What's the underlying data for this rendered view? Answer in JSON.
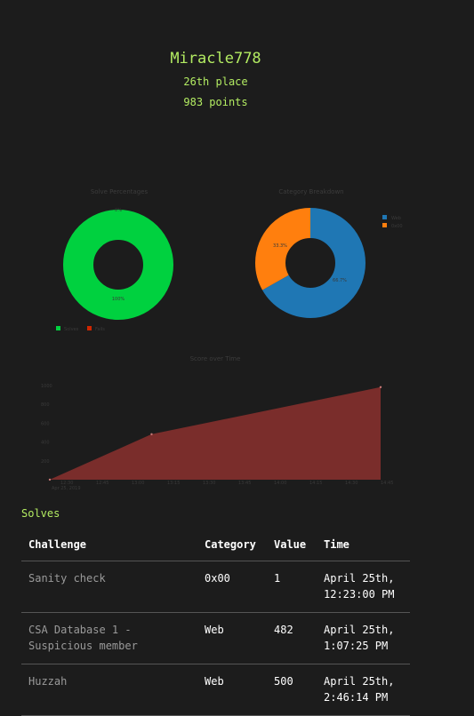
{
  "user": {
    "name": "Miracle778",
    "place": "26th place",
    "score": "983 points"
  },
  "charts": {
    "solve_title": "Solve Percentages",
    "category_title": "Category Breakdown",
    "score_title": "Score over Time"
  },
  "chart_data": [
    {
      "type": "pie",
      "title": "Solve Percentages",
      "labels": [
        "Solves",
        "Fails"
      ],
      "values": [
        100,
        0
      ],
      "slice_labels": [
        "0%",
        "100%"
      ],
      "colors": [
        "#00d13f",
        "#cf2600"
      ],
      "legend": "bottom-left"
    },
    {
      "type": "pie",
      "title": "Category Breakdown",
      "labels": [
        "Web",
        "0x00"
      ],
      "values": [
        66.7,
        33.3
      ],
      "slice_labels": [
        "66.7%",
        "33.3%"
      ],
      "colors": [
        "#1f77b4",
        "#ff7f0e"
      ],
      "legend": "top-right"
    },
    {
      "type": "area",
      "title": "Score over Time",
      "x": [
        "12:23",
        "13:07",
        "14:46"
      ],
      "y": [
        1,
        483,
        983
      ],
      "tick_labels": [
        "12:30\nApr 25, 2019",
        "12:45",
        "13:00",
        "13:15",
        "13:30",
        "13:45",
        "14:00",
        "14:15",
        "14:30",
        "14:45"
      ],
      "y_ticks": [
        "200",
        "400",
        "600",
        "800",
        "1000"
      ],
      "color": "#7a2d2b",
      "grid": false
    }
  ],
  "solves": {
    "heading": "Solves",
    "columns": [
      "Challenge",
      "Category",
      "Value",
      "Time"
    ],
    "rows": [
      {
        "challenge": "Sanity check",
        "category": "0x00",
        "value": "1",
        "time": "April 25th, 12:23:00 PM"
      },
      {
        "challenge": "CSA Database 1 - Suspicious member",
        "category": "Web",
        "value": "482",
        "time": "April 25th, 1:07:25 PM"
      },
      {
        "challenge": "Huzzah",
        "category": "Web",
        "value": "500",
        "time": "April 25th, 2:46:14 PM"
      }
    ]
  }
}
